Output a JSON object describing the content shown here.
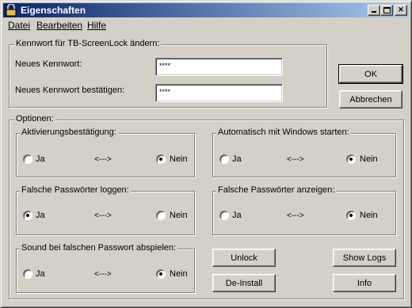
{
  "window": {
    "title": "Eigenschaften"
  },
  "menu": {
    "items": [
      "Datei",
      "Bearbeiten",
      "Hilfe"
    ]
  },
  "password_group": {
    "legend": "Kennwort für TB-ScreenLock ändern:",
    "new_label": "Neues Kennwort:",
    "new_value": "****",
    "confirm_label": "Neues Kennwort bestätigen:",
    "confirm_value": "****"
  },
  "buttons": {
    "ok": "OK",
    "cancel": "Abbrechen",
    "unlock": "Unlock",
    "show_logs": "Show Logs",
    "deinstall": "De-Install",
    "info": "Info"
  },
  "options": {
    "legend": "Optionen:",
    "groups": [
      {
        "legend": "Aktivierungsbestätigung:",
        "ja": "Ja",
        "arrow": "<--->",
        "nein": "Nein",
        "selected": "Nein"
      },
      {
        "legend": "Automatisch mit Windows starten:",
        "ja": "Ja",
        "arrow": "<--->",
        "nein": "Nein",
        "selected": "Nein"
      },
      {
        "legend": "Falsche Passwörter loggen:",
        "ja": "Ja",
        "arrow": "<--->",
        "nein": "Nein",
        "selected": "Ja"
      },
      {
        "legend": "Falsche Passwörter anzeigen:",
        "ja": "Ja",
        "arrow": "<--->",
        "nein": "Nein",
        "selected": "Nein"
      },
      {
        "legend": "Sound bei falschen Passwort abspielen:",
        "ja": "Ja",
        "arrow": "<--->",
        "nein": "Nein",
        "selected": "Nein"
      }
    ]
  }
}
